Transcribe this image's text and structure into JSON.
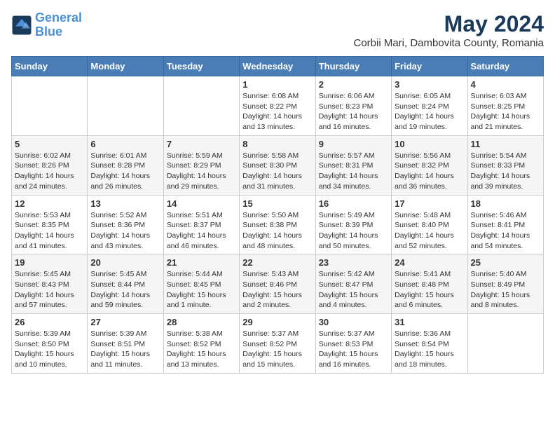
{
  "header": {
    "logo_line1": "General",
    "logo_line2": "Blue",
    "main_title": "May 2024",
    "subtitle": "Corbii Mari, Dambovita County, Romania"
  },
  "weekdays": [
    "Sunday",
    "Monday",
    "Tuesday",
    "Wednesday",
    "Thursday",
    "Friday",
    "Saturday"
  ],
  "weeks": [
    [
      {
        "day": "",
        "info": ""
      },
      {
        "day": "",
        "info": ""
      },
      {
        "day": "",
        "info": ""
      },
      {
        "day": "1",
        "info": "Sunrise: 6:08 AM\nSunset: 8:22 PM\nDaylight: 14 hours\nand 13 minutes."
      },
      {
        "day": "2",
        "info": "Sunrise: 6:06 AM\nSunset: 8:23 PM\nDaylight: 14 hours\nand 16 minutes."
      },
      {
        "day": "3",
        "info": "Sunrise: 6:05 AM\nSunset: 8:24 PM\nDaylight: 14 hours\nand 19 minutes."
      },
      {
        "day": "4",
        "info": "Sunrise: 6:03 AM\nSunset: 8:25 PM\nDaylight: 14 hours\nand 21 minutes."
      }
    ],
    [
      {
        "day": "5",
        "info": "Sunrise: 6:02 AM\nSunset: 8:26 PM\nDaylight: 14 hours\nand 24 minutes."
      },
      {
        "day": "6",
        "info": "Sunrise: 6:01 AM\nSunset: 8:28 PM\nDaylight: 14 hours\nand 26 minutes."
      },
      {
        "day": "7",
        "info": "Sunrise: 5:59 AM\nSunset: 8:29 PM\nDaylight: 14 hours\nand 29 minutes."
      },
      {
        "day": "8",
        "info": "Sunrise: 5:58 AM\nSunset: 8:30 PM\nDaylight: 14 hours\nand 31 minutes."
      },
      {
        "day": "9",
        "info": "Sunrise: 5:57 AM\nSunset: 8:31 PM\nDaylight: 14 hours\nand 34 minutes."
      },
      {
        "day": "10",
        "info": "Sunrise: 5:56 AM\nSunset: 8:32 PM\nDaylight: 14 hours\nand 36 minutes."
      },
      {
        "day": "11",
        "info": "Sunrise: 5:54 AM\nSunset: 8:33 PM\nDaylight: 14 hours\nand 39 minutes."
      }
    ],
    [
      {
        "day": "12",
        "info": "Sunrise: 5:53 AM\nSunset: 8:35 PM\nDaylight: 14 hours\nand 41 minutes."
      },
      {
        "day": "13",
        "info": "Sunrise: 5:52 AM\nSunset: 8:36 PM\nDaylight: 14 hours\nand 43 minutes."
      },
      {
        "day": "14",
        "info": "Sunrise: 5:51 AM\nSunset: 8:37 PM\nDaylight: 14 hours\nand 46 minutes."
      },
      {
        "day": "15",
        "info": "Sunrise: 5:50 AM\nSunset: 8:38 PM\nDaylight: 14 hours\nand 48 minutes."
      },
      {
        "day": "16",
        "info": "Sunrise: 5:49 AM\nSunset: 8:39 PM\nDaylight: 14 hours\nand 50 minutes."
      },
      {
        "day": "17",
        "info": "Sunrise: 5:48 AM\nSunset: 8:40 PM\nDaylight: 14 hours\nand 52 minutes."
      },
      {
        "day": "18",
        "info": "Sunrise: 5:46 AM\nSunset: 8:41 PM\nDaylight: 14 hours\nand 54 minutes."
      }
    ],
    [
      {
        "day": "19",
        "info": "Sunrise: 5:45 AM\nSunset: 8:43 PM\nDaylight: 14 hours\nand 57 minutes."
      },
      {
        "day": "20",
        "info": "Sunrise: 5:45 AM\nSunset: 8:44 PM\nDaylight: 14 hours\nand 59 minutes."
      },
      {
        "day": "21",
        "info": "Sunrise: 5:44 AM\nSunset: 8:45 PM\nDaylight: 15 hours\nand 1 minute."
      },
      {
        "day": "22",
        "info": "Sunrise: 5:43 AM\nSunset: 8:46 PM\nDaylight: 15 hours\nand 2 minutes."
      },
      {
        "day": "23",
        "info": "Sunrise: 5:42 AM\nSunset: 8:47 PM\nDaylight: 15 hours\nand 4 minutes."
      },
      {
        "day": "24",
        "info": "Sunrise: 5:41 AM\nSunset: 8:48 PM\nDaylight: 15 hours\nand 6 minutes."
      },
      {
        "day": "25",
        "info": "Sunrise: 5:40 AM\nSunset: 8:49 PM\nDaylight: 15 hours\nand 8 minutes."
      }
    ],
    [
      {
        "day": "26",
        "info": "Sunrise: 5:39 AM\nSunset: 8:50 PM\nDaylight: 15 hours\nand 10 minutes."
      },
      {
        "day": "27",
        "info": "Sunrise: 5:39 AM\nSunset: 8:51 PM\nDaylight: 15 hours\nand 11 minutes."
      },
      {
        "day": "28",
        "info": "Sunrise: 5:38 AM\nSunset: 8:52 PM\nDaylight: 15 hours\nand 13 minutes."
      },
      {
        "day": "29",
        "info": "Sunrise: 5:37 AM\nSunset: 8:52 PM\nDaylight: 15 hours\nand 15 minutes."
      },
      {
        "day": "30",
        "info": "Sunrise: 5:37 AM\nSunset: 8:53 PM\nDaylight: 15 hours\nand 16 minutes."
      },
      {
        "day": "31",
        "info": "Sunrise: 5:36 AM\nSunset: 8:54 PM\nDaylight: 15 hours\nand 18 minutes."
      },
      {
        "day": "",
        "info": ""
      }
    ]
  ]
}
